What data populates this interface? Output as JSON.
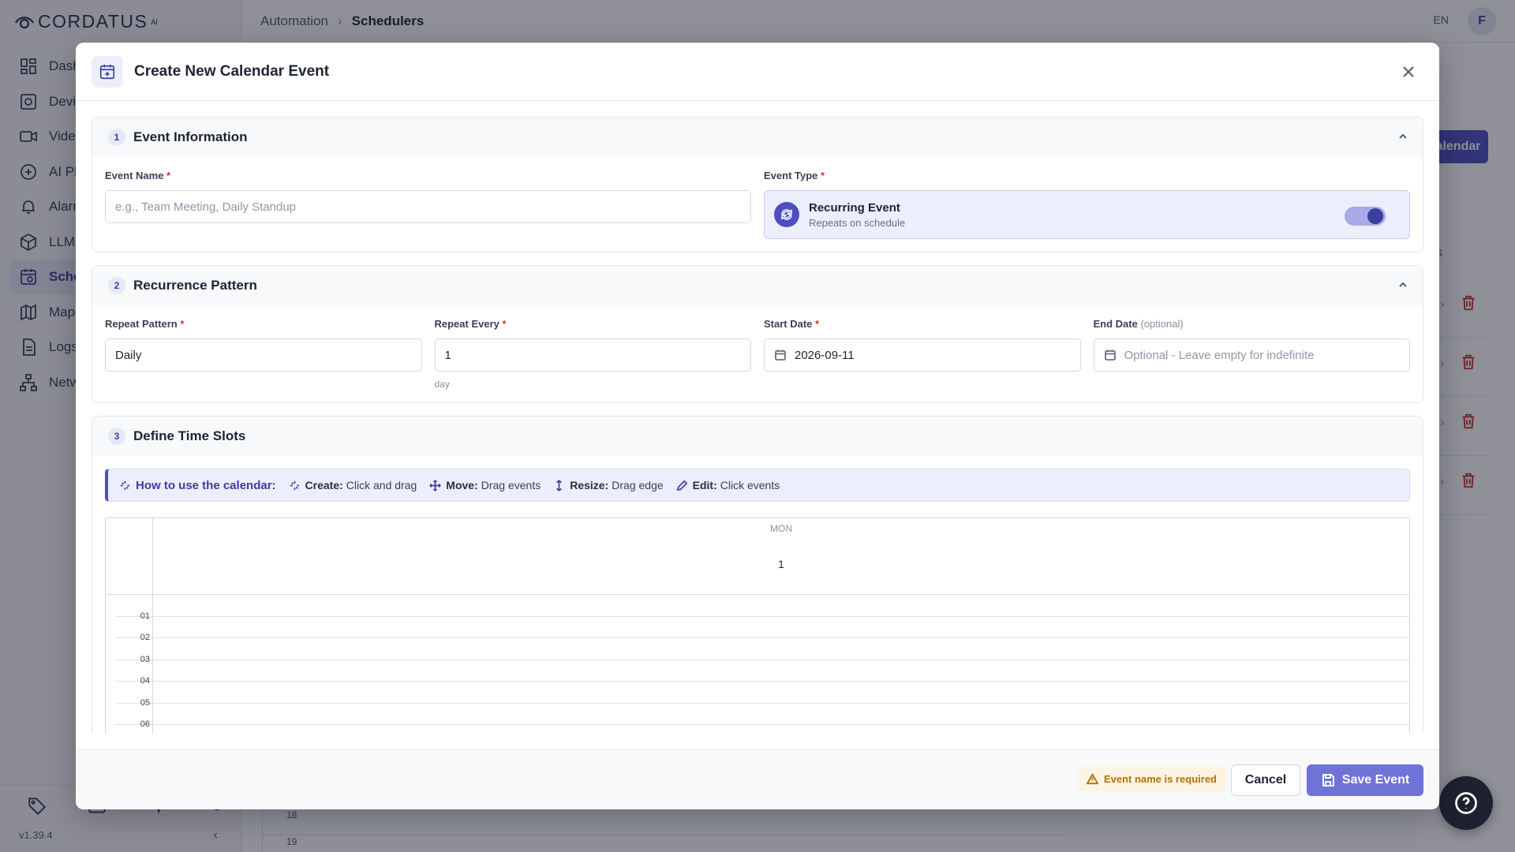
{
  "app": {
    "logo": "CORDATUS",
    "logo_mark": "AI",
    "version": "v1.39.4",
    "sidebar_items": [
      {
        "label": "Dashboard",
        "icon": "dashboard-icon"
      },
      {
        "label": "Devices",
        "icon": "devices-icon"
      },
      {
        "label": "Video",
        "icon": "video-icon"
      },
      {
        "label": "AI Platform",
        "icon": "ai-icon"
      },
      {
        "label": "Alarms",
        "icon": "bell-icon"
      },
      {
        "label": "LLM",
        "icon": "cube-icon"
      },
      {
        "label": "Schedulers",
        "icon": "scheduler-icon",
        "active": true
      },
      {
        "label": "Map",
        "icon": "map-icon"
      },
      {
        "label": "Logs",
        "icon": "logs-icon"
      },
      {
        "label": "Network",
        "icon": "network-icon"
      }
    ],
    "breadcrumb": {
      "parent": "Automation",
      "current": "Schedulers"
    },
    "language": "EN",
    "avatar_initial": "F",
    "bg_button": "Calendar",
    "bg_column": "s",
    "bg_hours": [
      "18",
      "19"
    ]
  },
  "modal": {
    "title": "Create New Calendar Event",
    "sections": {
      "event_info": {
        "step": "1",
        "title": "Event Information",
        "event_name_label": "Event Name",
        "event_name_placeholder": "e.g., Team Meeting, Daily Standup",
        "event_type_label": "Event Type",
        "event_type_title": "Recurring Event",
        "event_type_sub": "Repeats on schedule",
        "recurring_enabled": true
      },
      "recurrence": {
        "step": "2",
        "title": "Recurrence Pattern",
        "repeat_pattern_label": "Repeat Pattern",
        "repeat_pattern_value": "Daily",
        "repeat_every_label": "Repeat Every",
        "repeat_every_value": "1",
        "repeat_every_unit": "day",
        "start_date_label": "Start Date",
        "start_date_value": "2026-09-11",
        "end_date_label": "End Date",
        "end_date_optional": "(optional)",
        "end_date_placeholder": "Optional - Leave empty for indefinite"
      },
      "time_slots": {
        "step": "3",
        "title": "Define Time Slots",
        "howto_lead": "How to use the calendar:",
        "howto_items": [
          {
            "key": "Create:",
            "text": "Click and drag",
            "icon": "sparkle-icon"
          },
          {
            "key": "Move:",
            "text": "Drag events",
            "icon": "move-icon"
          },
          {
            "key": "Resize:",
            "text": "Drag edge",
            "icon": "resize-icon"
          },
          {
            "key": "Edit:",
            "text": "Click events",
            "icon": "pencil-icon"
          }
        ],
        "calendar": {
          "day_of_week": "MON",
          "date": "1",
          "hours": [
            "01",
            "02",
            "03",
            "04",
            "05",
            "06"
          ]
        }
      }
    },
    "footer": {
      "warning": "Event name is required",
      "cancel_label": "Cancel",
      "save_label": "Save Event"
    }
  }
}
